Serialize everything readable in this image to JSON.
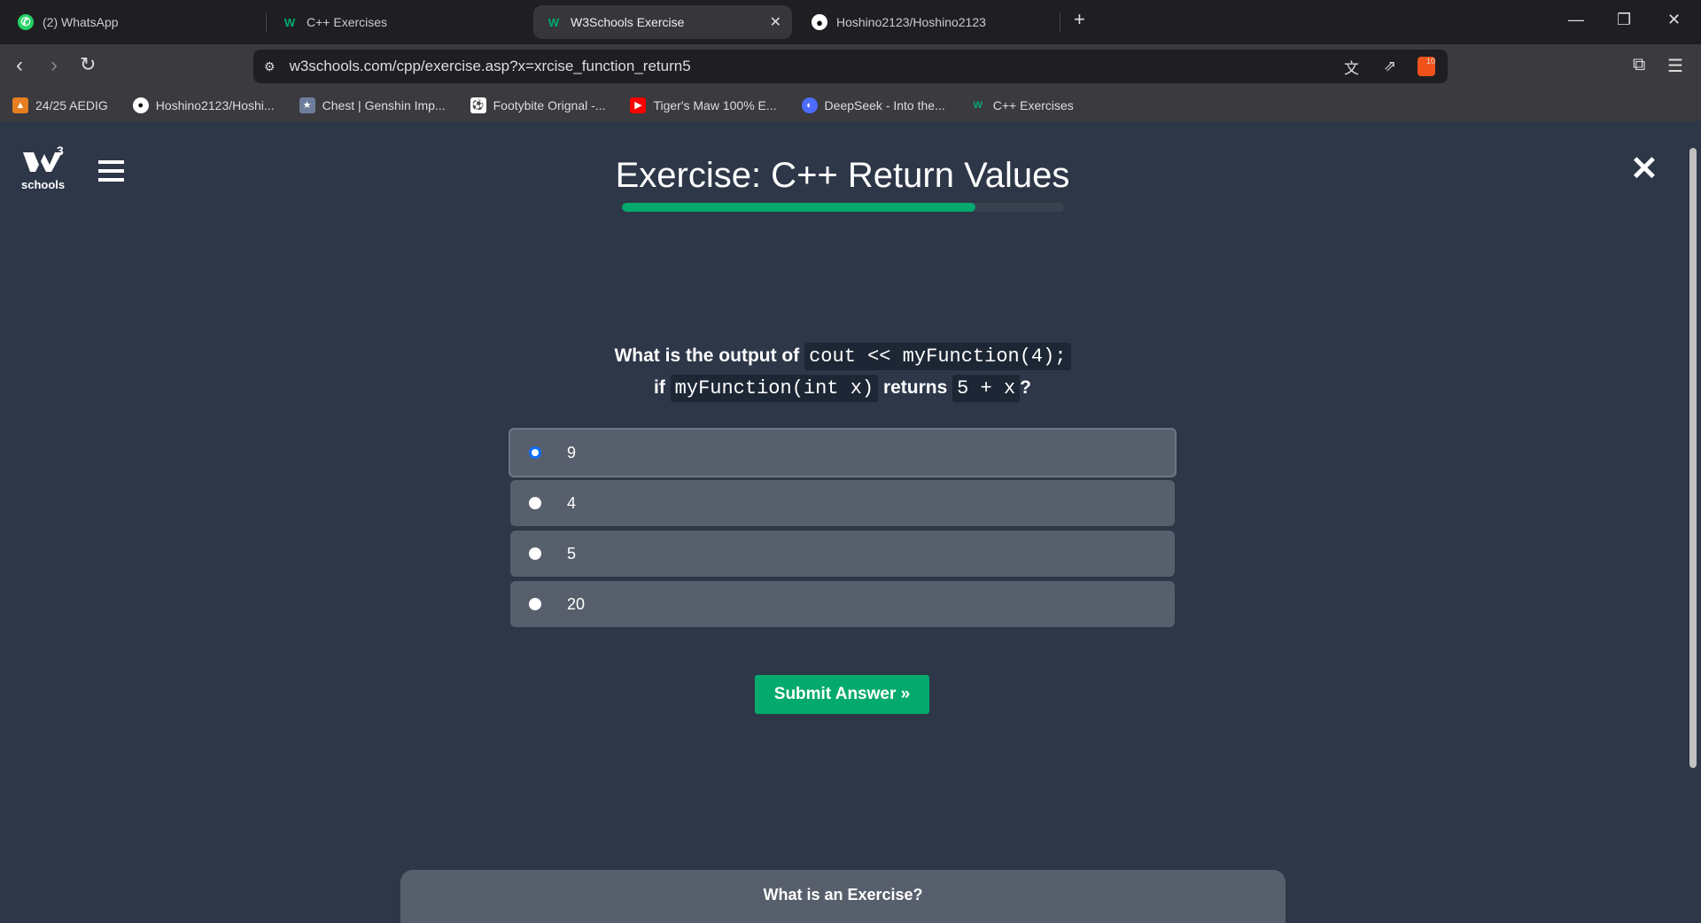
{
  "browser": {
    "tabs": [
      {
        "label": "(2) WhatsApp",
        "icon": "whatsapp-icon"
      },
      {
        "label": "C++ Exercises",
        "icon": "w3schools-icon"
      },
      {
        "label": "W3Schools Exercise",
        "icon": "w3schools-icon",
        "active": true
      },
      {
        "label": "Hoshino2123/Hoshino2123",
        "icon": "github-icon"
      }
    ],
    "url": "w3schools.com/cpp/exercise.asp?x=xrcise_function_return5",
    "bookmarks": [
      {
        "label": "24/25 AEDIG"
      },
      {
        "label": "Hoshino2123/Hoshi..."
      },
      {
        "label": "Chest | Genshin Imp..."
      },
      {
        "label": "Footybite Orignal -..."
      },
      {
        "label": "Tiger's Maw 100% E..."
      },
      {
        "label": "DeepSeek - Into the..."
      },
      {
        "label": "C++ Exercises"
      }
    ],
    "brave_badge": "10"
  },
  "page": {
    "logo_text": "schools",
    "logo_sup": "3",
    "title": "Exercise: C++ Return Values",
    "progress_percent": 80,
    "question": {
      "p1": "What is the output of",
      "c1": "cout << myFunction(4);",
      "p2": "if",
      "c2": "myFunction(int x)",
      "p3": "returns",
      "c3": "5 + x",
      "p4": "?"
    },
    "options": [
      "9",
      "4",
      "5",
      "20"
    ],
    "selected_index": 0,
    "submit_label": "Submit Answer »",
    "bottom_heading": "What is an Exercise?"
  },
  "colors": {
    "accent": "#04aa6d",
    "bg": "#2d3748",
    "option": "#585f6c"
  }
}
